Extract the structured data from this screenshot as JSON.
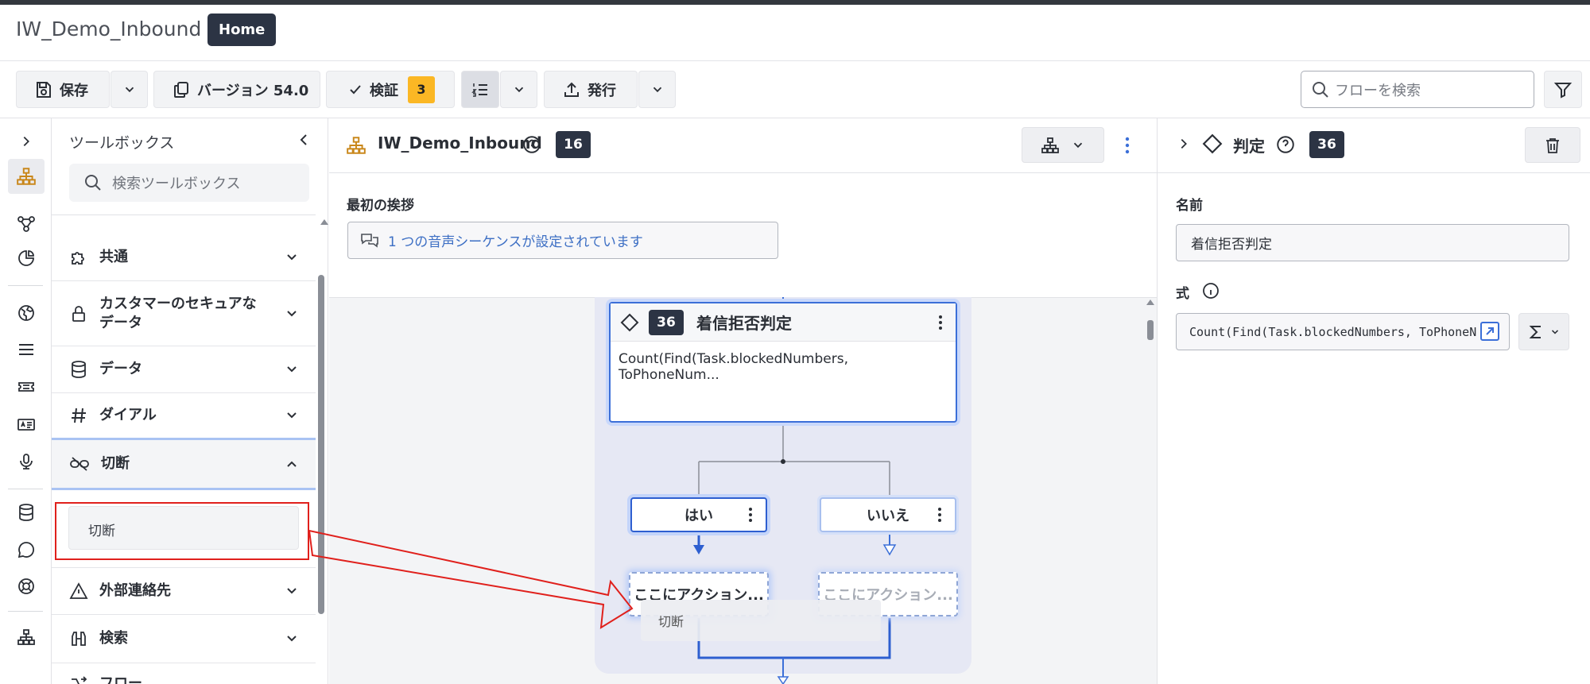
{
  "header": {
    "app_title": "IW_Demo_Inbound",
    "home_badge": "Home"
  },
  "toolbar": {
    "save_label": "保存",
    "version_label": "バージョン 54.0",
    "validate_label": "検証",
    "validate_count": "3",
    "publish_label": "発行",
    "search_placeholder": "フローを検索"
  },
  "toolbox": {
    "title": "ツールボックス",
    "search_placeholder": "検索ツールボックス",
    "categories": [
      {
        "label": "共通",
        "icon": "puzzle-icon",
        "expanded": false
      },
      {
        "label": "カスタマーのセキュアなデータ",
        "icon": "lock-icon",
        "expanded": false
      },
      {
        "label": "データ",
        "icon": "database-icon",
        "expanded": false
      },
      {
        "label": "ダイアル",
        "icon": "hash-icon",
        "expanded": false
      },
      {
        "label": "切断",
        "icon": "disconnect-icon",
        "expanded": true
      },
      {
        "label": "外部連絡先",
        "icon": "warning-icon",
        "expanded": false
      },
      {
        "label": "検索",
        "icon": "binoculars-icon",
        "expanded": false
      },
      {
        "label": "フロー",
        "icon": "flow-icon",
        "expanded": false
      }
    ],
    "disconnect_item": "切断"
  },
  "canvas": {
    "flow_title": "IW_Demo_Inbound",
    "flow_count": "16",
    "greeting_label": "最初の挨拶",
    "greeting_value": "1 つの音声シーケンスが設定されています",
    "decision": {
      "number": "36",
      "title": "着信拒否判定",
      "expression": "Count(Find(Task.blockedNumbers, ToPhoneNum..."
    },
    "outcome_yes": "はい",
    "outcome_no": "いいえ",
    "drop_target": "ここにアクション...",
    "drag_ghost": "切断"
  },
  "panel": {
    "type_label": "判定",
    "number": "36",
    "name_label": "名前",
    "name_value": "着信拒否判定",
    "expr_label": "式",
    "expr_value": "Count(Find(Task.blockedNumbers, ToPhoneN"
  },
  "colors": {
    "accent": "#3b6fd8",
    "badge_dark": "#2c3444",
    "warning_badge": "#fbb724",
    "annotation_red": "#e0201c"
  }
}
